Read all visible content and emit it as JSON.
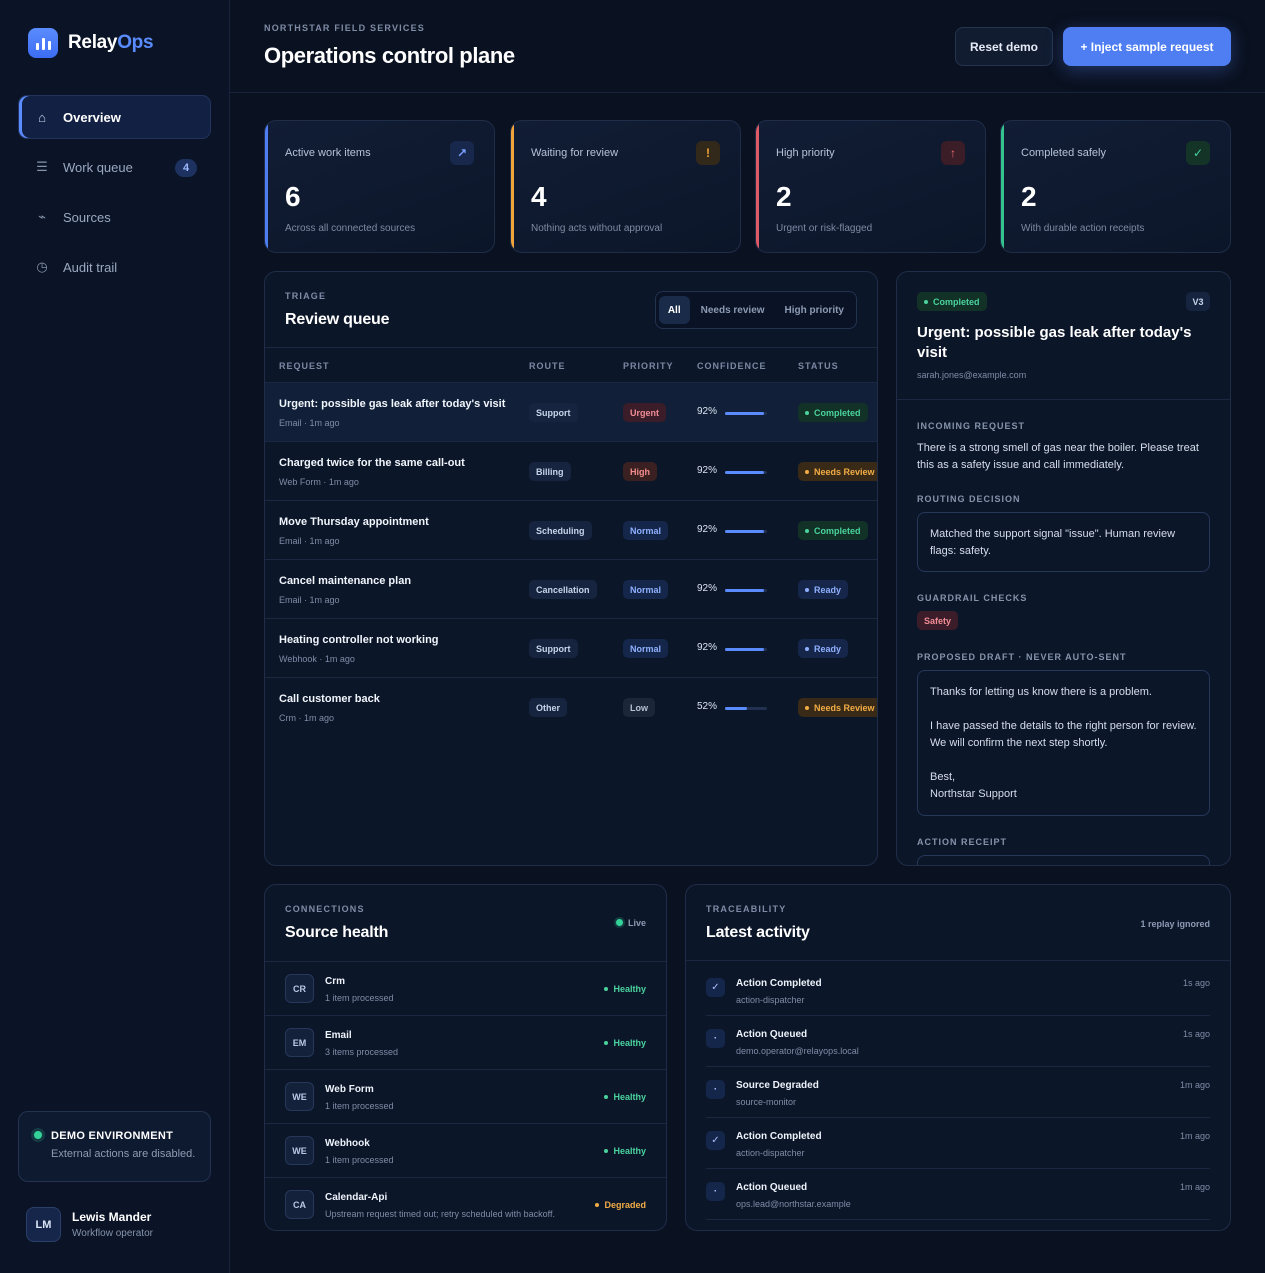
{
  "brand": {
    "name_main": "Relay",
    "name_accent": "Ops",
    "accent": "#5b8cff"
  },
  "nav": [
    {
      "label": "Overview",
      "icon": "home-icon",
      "active": true
    },
    {
      "label": "Work queue",
      "icon": "list-icon",
      "badge": "4"
    },
    {
      "label": "Sources",
      "icon": "signal-icon"
    },
    {
      "label": "Audit trail",
      "icon": "clock-icon"
    }
  ],
  "demo": {
    "title": "DEMO ENVIRONMENT",
    "subtitle": "External actions are disabled."
  },
  "user": {
    "initials": "LM",
    "name": "Lewis Mander",
    "role": "Workflow operator"
  },
  "header": {
    "eyebrow": "NORTHSTAR FIELD SERVICES",
    "title": "Operations control plane",
    "reset_label": "Reset demo",
    "inject_label": "+ Inject sample request"
  },
  "stats": [
    {
      "label": "Active work items",
      "value": "6",
      "sub": "Across all connected sources",
      "icon": "↗",
      "color": "#4f7ef3"
    },
    {
      "label": "Waiting for review",
      "value": "4",
      "sub": "Nothing acts without approval",
      "icon": "!",
      "color": "#f0a43a"
    },
    {
      "label": "High priority",
      "value": "2",
      "sub": "Urgent or risk-flagged",
      "icon": "↑",
      "color": "#e05a66"
    },
    {
      "label": "Completed safely",
      "value": "2",
      "sub": "With durable action receipts",
      "icon": "✓",
      "color": "#34c38f"
    }
  ],
  "queue": {
    "eyebrow": "TRIAGE",
    "title": "Review queue",
    "filters": [
      "All",
      "Needs review",
      "High priority"
    ],
    "columns": [
      "REQUEST",
      "ROUTE",
      "PRIORITY",
      "CONFIDENCE",
      "STATUS"
    ],
    "rows": [
      {
        "title": "Urgent: possible gas leak after today's visit",
        "meta": "Email · 1m ago",
        "route": "Support",
        "priority": "Urgent",
        "confidence": "92%",
        "confidence_value": 0.92,
        "status": "Completed"
      },
      {
        "title": "Charged twice for the same call-out",
        "meta": "Web Form · 1m ago",
        "route": "Billing",
        "priority": "High",
        "confidence": "92%",
        "confidence_value": 0.92,
        "status": "Needs Review"
      },
      {
        "title": "Move Thursday appointment",
        "meta": "Email · 1m ago",
        "route": "Scheduling",
        "priority": "Normal",
        "confidence": "92%",
        "confidence_value": 0.92,
        "status": "Completed"
      },
      {
        "title": "Cancel maintenance plan",
        "meta": "Email · 1m ago",
        "route": "Cancellation",
        "priority": "Normal",
        "confidence": "92%",
        "confidence_value": 0.92,
        "status": "Ready"
      },
      {
        "title": "Heating controller not working",
        "meta": "Webhook · 1m ago",
        "route": "Support",
        "priority": "Normal",
        "confidence": "92%",
        "confidence_value": 0.92,
        "status": "Ready"
      },
      {
        "title": "Call customer back",
        "meta": "Crm · 1m ago",
        "route": "Other",
        "priority": "Low",
        "confidence": "52%",
        "confidence_value": 0.52,
        "status": "Needs Review"
      }
    ]
  },
  "detail": {
    "status": "Completed",
    "version": "V3",
    "title": "Urgent: possible gas leak after today's visit",
    "email": "sarah.jones@example.com",
    "incoming_label": "INCOMING REQUEST",
    "incoming_text": "There is a strong smell of gas near the boiler. Please treat this as a safety issue and call immediately.",
    "routing_label": "ROUTING DECISION",
    "routing_text": "Matched the support signal \"issue\". Human review flags: safety.",
    "guardrail_label": "GUARDRAIL CHECKS",
    "guardrail_chip": "Safety",
    "draft_label": "PROPOSED DRAFT · NEVER AUTO-SENT",
    "draft_text": "Thanks for letting us know there is a problem.\n\nI have passed the details to the right person for review. We will confirm the next step shortly.\n\nBest,\nNorthstar Support",
    "receipt_label": "ACTION RECEIPT"
  },
  "sources": {
    "eyebrow": "CONNECTIONS",
    "title": "Source health",
    "live_label": "Live",
    "items": [
      {
        "code": "CR",
        "name": "Crm",
        "sub": "1 item processed",
        "status": "Healthy"
      },
      {
        "code": "EM",
        "name": "Email",
        "sub": "3 items processed",
        "status": "Healthy"
      },
      {
        "code": "WE",
        "name": "Web Form",
        "sub": "1 item processed",
        "status": "Healthy"
      },
      {
        "code": "WE",
        "name": "Webhook",
        "sub": "1 item processed",
        "status": "Healthy"
      },
      {
        "code": "CA",
        "name": "Calendar-Api",
        "sub": "Upstream request timed out; retry scheduled with backoff.",
        "status": "Degraded"
      }
    ]
  },
  "activity": {
    "eyebrow": "TRACEABILITY",
    "title": "Latest activity",
    "replay_label": "1 replay ignored",
    "items": [
      {
        "icon": "✓",
        "title": "Action Completed",
        "sub": "action-dispatcher",
        "time": "1s ago"
      },
      {
        "icon": "·",
        "title": "Action Queued",
        "sub": "demo.operator@relayops.local",
        "time": "1s ago"
      },
      {
        "icon": "·",
        "title": "Source Degraded",
        "sub": "source-monitor",
        "time": "1m ago"
      },
      {
        "icon": "✓",
        "title": "Action Completed",
        "sub": "action-dispatcher",
        "time": "1m ago"
      },
      {
        "icon": "·",
        "title": "Action Queued",
        "sub": "ops.lead@northstar.example",
        "time": "1m ago"
      }
    ]
  }
}
